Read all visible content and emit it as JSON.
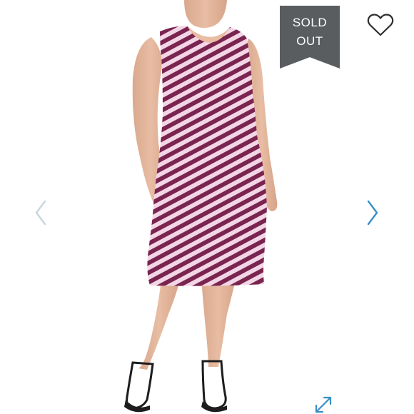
{
  "badge": {
    "line1": "SOLD",
    "line2": "OUT",
    "color": "#5a5d60"
  },
  "icons": {
    "favorite": "heart-outline-icon",
    "previous": "chevron-left-icon",
    "next": "chevron-right-icon",
    "fullscreen": "expand-arrows-icon"
  },
  "colors": {
    "stripe_dark": "#7a2450",
    "stripe_light": "#f3d6e6",
    "accent_arrow": "#3a8fc4",
    "arrow_muted": "#c8d6de"
  }
}
